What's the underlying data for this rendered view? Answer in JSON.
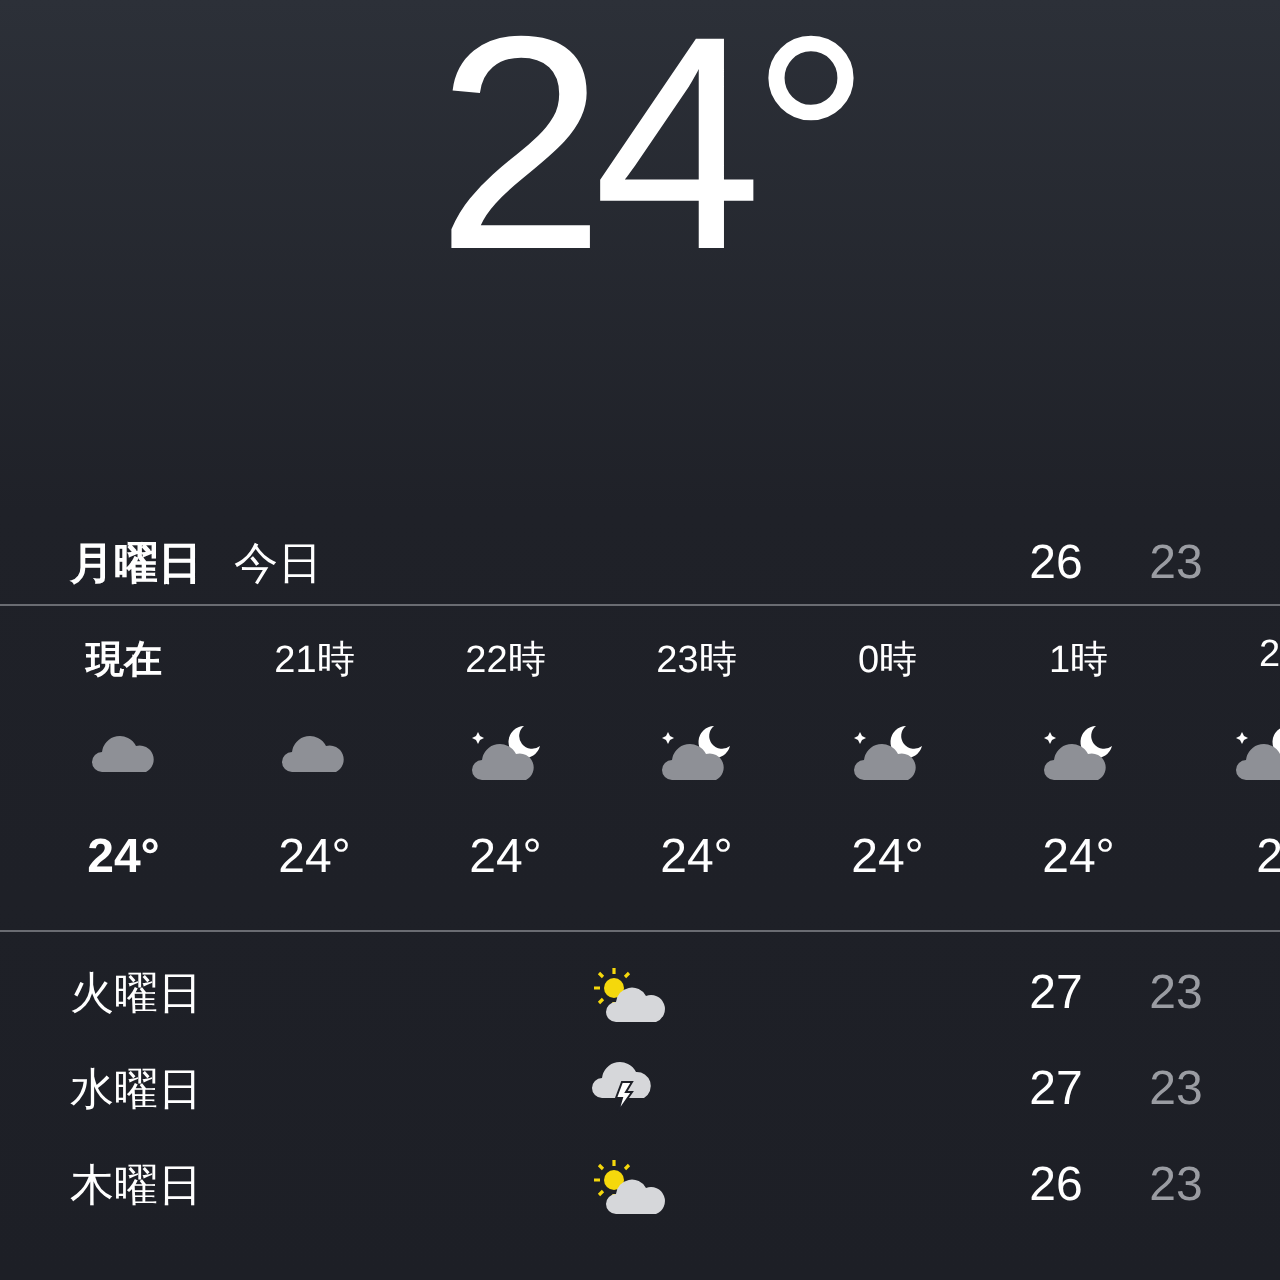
{
  "current_temp": "24°",
  "today": {
    "day": "月曜日",
    "label": "今日",
    "high": "26",
    "low": "23"
  },
  "hourly": [
    {
      "time": "現在",
      "kind": "cloud",
      "temp": "24°",
      "now": true
    },
    {
      "time": "21時",
      "kind": "cloud",
      "temp": "24°",
      "now": false
    },
    {
      "time": "22時",
      "kind": "night",
      "temp": "24°",
      "now": false
    },
    {
      "time": "23時",
      "kind": "night",
      "temp": "24°",
      "now": false
    },
    {
      "time": "0時",
      "kind": "night",
      "temp": "24°",
      "now": false
    },
    {
      "time": "1時",
      "kind": "night",
      "temp": "24°",
      "now": false
    },
    {
      "time": "2",
      "kind": "night",
      "temp": "2",
      "now": false
    }
  ],
  "daily": [
    {
      "day": "火曜日",
      "kind": "sun",
      "high": "27",
      "low": "23"
    },
    {
      "day": "水曜日",
      "kind": "thunder",
      "high": "27",
      "low": "23"
    },
    {
      "day": "木曜日",
      "kind": "sun",
      "high": "26",
      "low": "23"
    }
  ]
}
